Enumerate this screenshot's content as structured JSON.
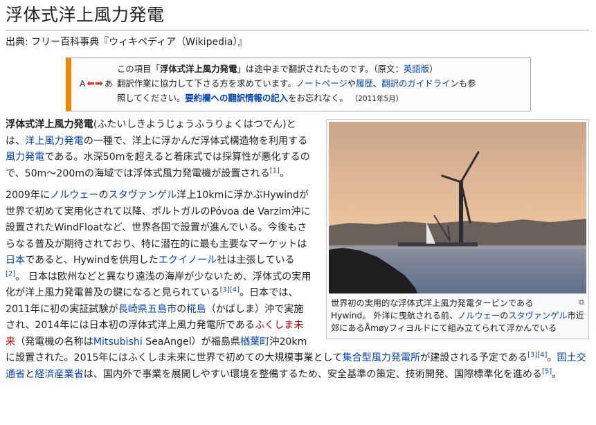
{
  "title": "浮体式洋上風力発電",
  "source": "出典: フリー百科事典『ウィキペディア（Wikipedia）』",
  "notice": {
    "icon_letter_a": "A",
    "icon_letter_b": "あ",
    "line1_a": "この項目「",
    "line1_bold": "浮体式洋上風力発電",
    "line1_b": "」は途中まで翻訳されたものです。（原文：",
    "line1_link": "英語版",
    "line1_c": "）",
    "line2_a": "翻訳作業に協力して下さる方を求めています。",
    "line2_link1": "ノートページ",
    "line2_b": "や",
    "line2_link2": "履歴",
    "line2_c": "、",
    "line2_link3": "翻訳のガイドライン",
    "line2_d": "も参",
    "line3_a": "照してください。",
    "line3_link": "要約欄への翻訳情報の記入",
    "line3_b": "をお忘れなく。",
    "date": "（2011年5月）"
  },
  "figure": {
    "caption_a": "世界初の実用的な浮体式洋上風力発電タービンである Hywind。 外洋に曳航される前、",
    "caption_link1": "ノルウェー",
    "caption_b": "の",
    "caption_link2": "スタヴァンゲル",
    "caption_c": "市近郊にあるÅmøyフィヨルドにて組み立てられて浮かんでいる",
    "magnify": "⧉"
  },
  "para1": {
    "bold": "浮体式洋上風力発電",
    "a": "(ふたいしきようじょうふうりょくはつでん)とは、",
    "link1": "洋上風力発電",
    "b": "の一種で、洋上に浮かんだ浮体式構造物を利用する",
    "link2": "風力発電",
    "c": "である。水深50mを超えると着床式では採算性が悪化するので、50m〜200mの海域では浮体式風力発電機が設置される",
    "ref1": "[1]",
    "d": "。"
  },
  "para2": {
    "a": "2009年に",
    "link1": "ノルウェー",
    "b": "の",
    "link2": "スタヴァンゲル",
    "c": "洋上10kmに浮かぶHywindが世界で初めて実用化されて以降、ポルトガルのPóvoa de Varzim沖に設置されたWindFloatなど、世界各国で設置が進んでいる。今後もさらなる普及が期待されており、特に潜在的に最も主要なマーケットは",
    "link3": "日本",
    "d": "であると、Hywindを供用した",
    "link4": "エクイノール",
    "e": "社は主張している",
    "ref2": "[2]",
    "f": "。 日本は欧州などと異なり遠浅の海岸が少ないため、浮体式の実用化が洋上風力発電普及の鍵になると見られている",
    "ref3": "[3]",
    "ref4": "[4]",
    "g": "。日本では、2011年に初の実証試験が",
    "link5": "長崎県",
    "link6": "五島市",
    "h": "の",
    "link7": "椛島",
    "i": "（かばしま）沖で実施され、2014年には日本初の浮体式洋上風力発電所である",
    "redlink": "ふくしま未来",
    "j": "（発電機の名称は",
    "link8": "Mitsubishi",
    "k": " SeaAngel）が福島県",
    "link9": "楢葉町",
    "l": "沖20kmに設置された。2015年にはふくしま未来に世界で初めての大規模事業として",
    "link10": "集合型風力発電所",
    "m": "が建設される予定である",
    "ref5": "[3]",
    "ref6": "[4]",
    "n": "。",
    "link11": "国土交通省",
    "o": "と",
    "link12": "経済産業省",
    "p": "は、国内外で事業を展開しやすい環境を整備するため、安全基準の策定、技術開発、国際標準化を進める",
    "ref7": "[5]",
    "q": "。"
  },
  "colors": {
    "link": "#0645ad",
    "redlink": "#ba0000",
    "notice_accent": "#f28500",
    "sky_top": "#c9a68a",
    "sky_bottom": "#f0c9a0",
    "sea": "#6f7f97"
  }
}
